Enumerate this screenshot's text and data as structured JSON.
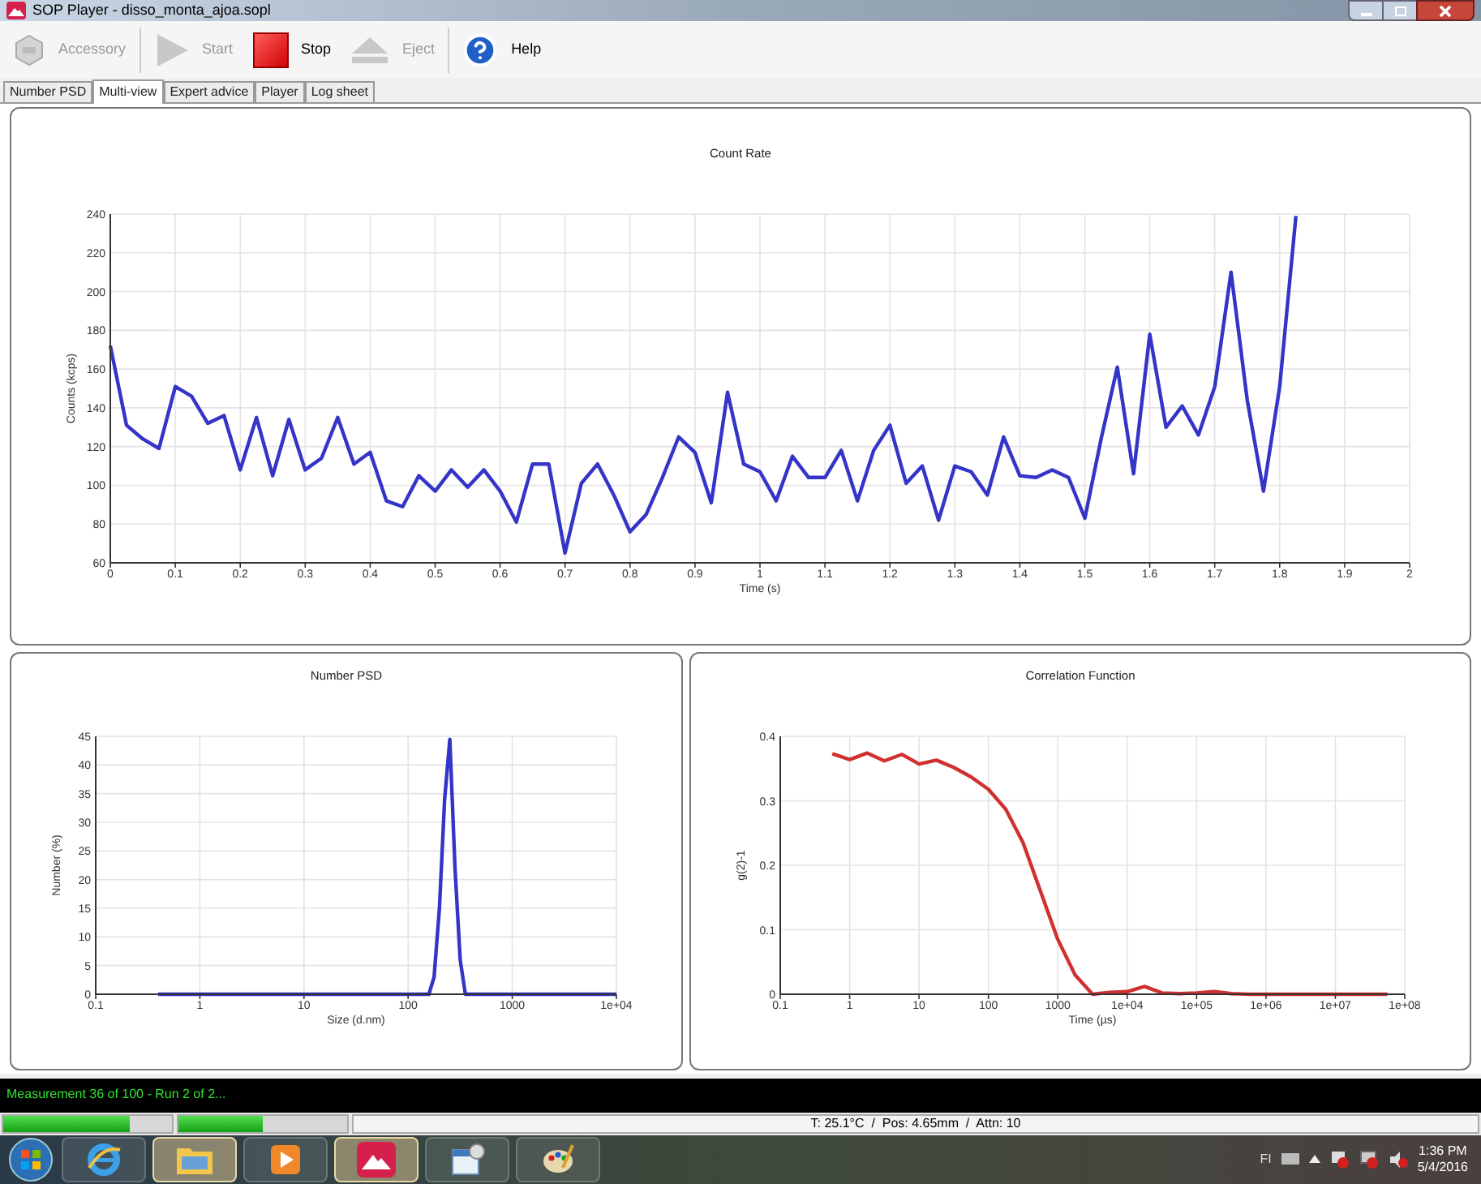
{
  "window": {
    "title": "SOP Player - disso_monta_ajoa.sopl"
  },
  "toolbar": [
    {
      "label": "Accessory",
      "kind": "accessory",
      "disabled": true
    },
    {
      "label": "Start",
      "kind": "start",
      "disabled": true
    },
    {
      "label": "Stop",
      "kind": "stop",
      "disabled": false
    },
    {
      "label": "Eject",
      "kind": "eject",
      "disabled": true
    },
    {
      "label": "Help",
      "kind": "help",
      "disabled": false
    }
  ],
  "tabs": [
    {
      "label": "Number PSD",
      "selected": false
    },
    {
      "label": "Multi-view",
      "selected": true
    },
    {
      "label": "Expert advice",
      "selected": false
    },
    {
      "label": "Player",
      "selected": false
    },
    {
      "label": "Log sheet",
      "selected": false
    }
  ],
  "count_rate": {
    "chart_data": {
      "type": "line",
      "title": "Count Rate",
      "xlabel": "Time (s)",
      "ylabel": "Counts (kcps)",
      "grid": true,
      "xlim": [
        0,
        2
      ],
      "ylim": [
        60,
        240
      ],
      "xticks": [
        0,
        0.1,
        0.2,
        0.3,
        0.4,
        0.5,
        0.6,
        0.7,
        0.8,
        0.9,
        1,
        1.1,
        1.2,
        1.3,
        1.4,
        1.5,
        1.6,
        1.7,
        1.8,
        1.9,
        2
      ],
      "yticks": [
        60,
        80,
        100,
        120,
        140,
        160,
        180,
        200,
        220,
        240
      ],
      "x": [
        0,
        0.025,
        0.05,
        0.075,
        0.1,
        0.125,
        0.15,
        0.175,
        0.2,
        0.225,
        0.25,
        0.275,
        0.3,
        0.325,
        0.35,
        0.375,
        0.4,
        0.425,
        0.45,
        0.475,
        0.5,
        0.525,
        0.55,
        0.575,
        0.6,
        0.625,
        0.65,
        0.675,
        0.7,
        0.725,
        0.75,
        0.775,
        0.8,
        0.825,
        0.85,
        0.875,
        0.9,
        0.925,
        0.95,
        0.975,
        1,
        1.025,
        1.05,
        1.075,
        1.1,
        1.125,
        1.15,
        1.175,
        1.2,
        1.225,
        1.25,
        1.275,
        1.3,
        1.325,
        1.35,
        1.375,
        1.4,
        1.425,
        1.45,
        1.475,
        1.5,
        1.525,
        1.55,
        1.575,
        1.6,
        1.625,
        1.65,
        1.675,
        1.7,
        1.725,
        1.75,
        1.775,
        1.8,
        1.825
      ],
      "series": [
        {
          "color": "#3434c8",
          "values": [
            172,
            131,
            124,
            119,
            151,
            146,
            132,
            136,
            108,
            135,
            105,
            134,
            108,
            114,
            135,
            111,
            117,
            92,
            89,
            105,
            97,
            108,
            99,
            108,
            97,
            81,
            111,
            111,
            65,
            101,
            111,
            95,
            76,
            85,
            104,
            125,
            117,
            91,
            148,
            111,
            107,
            92,
            115,
            104,
            104,
            118,
            92,
            118,
            131,
            101,
            110,
            82,
            110,
            107,
            95,
            125,
            105,
            104,
            108,
            104,
            83,
            124,
            161,
            106,
            178,
            130,
            141,
            126,
            151,
            210,
            144,
            97,
            151,
            239
          ]
        }
      ]
    }
  },
  "number_psd": {
    "chart_data": {
      "type": "line",
      "title": "Number PSD",
      "xlabel": "Size (d.nm)",
      "ylabel": "Number (%)",
      "grid": true,
      "ylim": [
        0,
        45
      ],
      "categories": [
        "0.1",
        null,
        null,
        null,
        null,
        null,
        null,
        null,
        null,
        null,
        null,
        null,
        null,
        null,
        null,
        null,
        null,
        null,
        null,
        null,
        "1",
        null,
        null,
        null,
        null,
        null,
        null,
        null,
        null,
        null,
        null,
        null,
        null,
        null,
        null,
        null,
        null,
        null,
        null,
        null,
        "10",
        null,
        null,
        null,
        null,
        null,
        null,
        null,
        null,
        null,
        null,
        null,
        null,
        null,
        null,
        null,
        null,
        null,
        null,
        null,
        "100",
        null,
        null,
        null,
        null,
        null,
        null,
        null,
        null,
        null,
        null,
        null,
        null,
        null,
        null,
        null,
        null,
        null,
        null,
        null,
        "1000",
        null,
        null,
        null,
        null,
        null,
        null,
        null,
        null,
        null,
        null,
        null,
        null,
        null,
        null,
        null,
        null,
        null,
        null,
        null,
        "1e+04"
      ],
      "yticks": [
        0,
        5,
        10,
        15,
        20,
        25,
        30,
        35,
        40,
        45
      ],
      "series": [
        {
          "color": "#3434c8",
          "values": [
            null,
            null,
            null,
            null,
            null,
            null,
            null,
            null,
            null,
            null,
            null,
            null,
            0,
            0,
            0,
            0,
            0,
            0,
            0,
            0,
            0,
            0,
            0,
            0,
            0,
            0,
            0,
            0,
            0,
            0,
            0,
            0,
            0,
            0,
            0,
            0,
            0,
            0,
            0,
            0,
            0,
            0,
            0,
            0,
            0,
            0,
            0,
            0,
            0,
            0,
            0,
            0,
            0,
            0,
            0,
            0,
            0,
            0,
            0,
            0,
            0,
            0,
            0,
            0,
            0,
            3,
            15,
            34,
            44.5,
            22,
            6,
            0,
            0,
            0,
            0,
            0,
            0,
            0,
            0,
            0,
            0,
            0,
            0,
            0,
            0,
            0,
            0,
            0,
            0,
            0,
            0,
            0,
            0,
            0,
            0,
            0,
            0,
            0,
            0,
            0,
            0
          ]
        }
      ]
    }
  },
  "correlation": {
    "chart_data": {
      "type": "line",
      "title": "Correlation Function",
      "xlabel": "Time (µs)",
      "ylabel": "g(2)-1",
      "grid": true,
      "ylim": [
        0,
        0.4
      ],
      "categories": [
        "0.1",
        null,
        null,
        null,
        "1",
        null,
        null,
        null,
        "10",
        null,
        null,
        null,
        "100",
        null,
        null,
        null,
        "1000",
        null,
        null,
        null,
        "1e+04",
        null,
        null,
        null,
        "1e+05",
        null,
        null,
        null,
        "1e+06",
        null,
        null,
        null,
        "1e+07",
        null,
        null,
        null,
        "1e+08"
      ],
      "yticks": [
        0,
        0.1,
        0.2,
        0.3,
        0.4
      ],
      "series": [
        {
          "color": "#d03030",
          "values": [
            null,
            null,
            null,
            0.373,
            0.364,
            0.374,
            0.362,
            0.372,
            0.357,
            0.363,
            0.352,
            0.337,
            0.318,
            0.287,
            0.235,
            0.16,
            0.085,
            0.03,
            0,
            0.003,
            0.004,
            0.012,
            0.002,
            0.001,
            0.002,
            0.004,
            0.001,
            0,
            0,
            0,
            0,
            0,
            0,
            0,
            0,
            0,
            null
          ]
        }
      ]
    }
  },
  "status": {
    "message": "Measurement 36 of 100 -  Run 2 of 2...",
    "progress": [
      {
        "level": 0.75
      },
      {
        "level": 0.5
      }
    ],
    "readout": "T: 25.1°C  /  Pos: 4.65mm  /  Attn: 10"
  },
  "taskbar": {
    "tray_label": "FI",
    "time": "1:36 PM",
    "date": "5/4/2016"
  }
}
